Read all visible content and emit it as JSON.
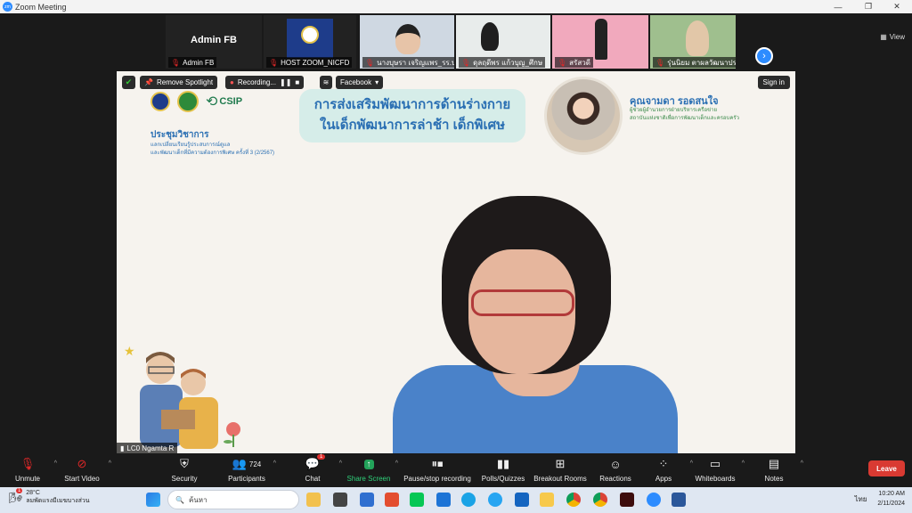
{
  "window": {
    "title": "Zoom Meeting",
    "minimize": "—",
    "restore": "❐",
    "close": "✕"
  },
  "strip": {
    "view_label": "View",
    "tiles": [
      {
        "name": "Admin FB",
        "big": "Admin FB"
      },
      {
        "name": "HOST ZOOM_NICFD"
      },
      {
        "name": "นางบุษรา เจริญแพร_รร.ป"
      },
      {
        "name": "ดุลฤดีพร แก้วบุญ_ศึกษ"
      },
      {
        "name": "สรัสวดี"
      },
      {
        "name": "รุ่นนิยม ตาผลวัฒนาประยุ"
      }
    ]
  },
  "stage": {
    "remove_spotlight": "Remove Spotlight",
    "recording": "Recording...",
    "facebook": "Facebook",
    "sign_in": "Sign in",
    "csip": "CSIP",
    "title_line1": "การส่งเสริมพัฒนาการด้านร่างกาย",
    "title_line2": "ในเด็กพัฒนาการล่าช้า เด็กพิเศษ",
    "left_heading": "ประชุมวิชาการ",
    "left_sub1": "แลกเปลี่ยนเรียนรู้ประสบการณ์ดูแล",
    "left_sub2": "และพัฒนาเด็กที่มีความต้องการพิเศษ ครั้งที่ 3 (2/2567)",
    "speaker_name": "คุณจามดา รอดสนใจ",
    "speaker_role1": "ผู้ช่วยผู้อำนวยการฝ่ายบริหารเครือข่าย",
    "speaker_role2": "สถาบันแห่งชาติเพื่อการพัฒนาเด็กและครอบครัว",
    "active_name": "LC0 Ngamta R"
  },
  "controls": [
    {
      "label": "Unmute",
      "icon": "mic-muted-icon"
    },
    {
      "label": "Start Video",
      "icon": "video-off-icon"
    },
    {
      "label": "Security",
      "icon": "shield-icon"
    },
    {
      "label": "Participants",
      "icon": "participants-icon",
      "count": "724"
    },
    {
      "label": "Chat",
      "icon": "chat-icon",
      "badge": "1"
    },
    {
      "label": "Share Screen",
      "icon": "share-screen-icon"
    },
    {
      "label": "Pause/stop recording",
      "icon": "recording-icon"
    },
    {
      "label": "Polls/Quizzes",
      "icon": "polls-icon"
    },
    {
      "label": "Breakout Rooms",
      "icon": "breakout-icon"
    },
    {
      "label": "Reactions",
      "icon": "reactions-icon"
    },
    {
      "label": "Apps",
      "icon": "apps-icon"
    },
    {
      "label": "Whiteboards",
      "icon": "whiteboard-icon"
    },
    {
      "label": "Notes",
      "icon": "notes-icon"
    }
  ],
  "leave_label": "Leave",
  "taskbar": {
    "temp": "28°C",
    "weather_text": "ลมพัดแรงมีเมฆบางส่วน",
    "weather_badge": "1",
    "search_placeholder": "ค้นหา",
    "lang": "ไทย",
    "time": "10:20 AM",
    "date": "2/11/2024"
  }
}
